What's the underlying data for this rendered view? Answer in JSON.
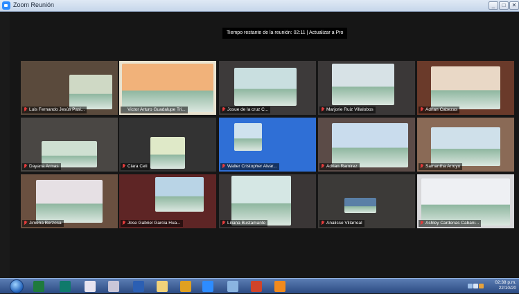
{
  "window": {
    "title": "Zoom Reunión",
    "minimize": "_",
    "maximize": "□",
    "close": "✕"
  },
  "banner": {
    "text": "Tiempo restante de la reunión: 02:11 | Actualizar a Pro"
  },
  "participants": [
    {
      "name": "Luis Fernando Jesús Pasi...",
      "muted": true
    },
    {
      "name": "Victor Arturo Guadalupe Tri...",
      "muted": false,
      "active": true
    },
    {
      "name": "Josue de la cruz C...",
      "muted": true
    },
    {
      "name": "Marjorie Ruiz Villalobos",
      "muted": true
    },
    {
      "name": "Adrian Cabezas",
      "muted": true
    },
    {
      "name": "Dayana Armas",
      "muted": true
    },
    {
      "name": "Ciara Celi",
      "muted": true
    },
    {
      "name": "Walter Cristopher Alvar...",
      "muted": true
    },
    {
      "name": "Adrian Ramirez",
      "muted": true
    },
    {
      "name": "Samantha Arroyo",
      "muted": true
    },
    {
      "name": "Jimena Berzosa",
      "muted": true
    },
    {
      "name": "Jose Gabriel Garcia Hua...",
      "muted": true
    },
    {
      "name": "Liliana Bustamante",
      "muted": true
    },
    {
      "name": "Analisse Villarreal",
      "muted": true
    },
    {
      "name": "Ashley Cardenas Cabani...",
      "muted": true
    }
  ],
  "taskbar": {
    "icons": [
      "windows-start-icon",
      "excel-icon",
      "publisher-icon",
      "paint-icon",
      "tool-icon",
      "word-icon",
      "file-explorer-icon",
      "chrome-icon",
      "zoom-icon",
      "network-icon",
      "powerpoint-icon",
      "media-player-icon"
    ],
    "clock_time": "02:38 p.m.",
    "clock_date": "22/10/20"
  },
  "colors": {
    "active_speaker_border": "#d7d74a",
    "muted_icon": "#e23b3b",
    "taskbar": "#2b4a82"
  }
}
